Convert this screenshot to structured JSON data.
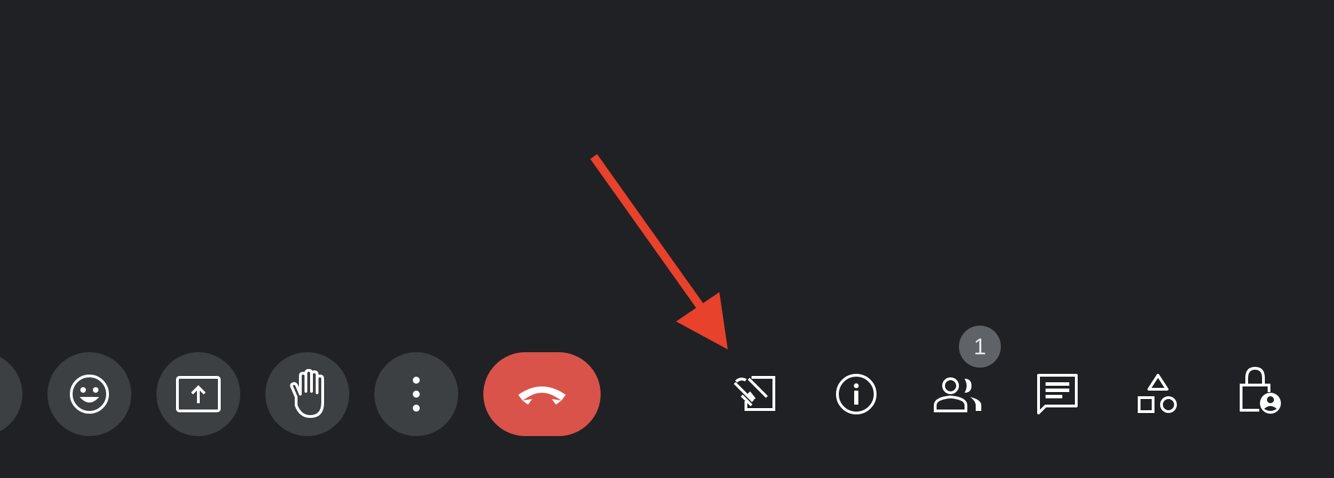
{
  "toolbar": {
    "left_buttons": [
      {
        "name": "partial-button",
        "icon": "partial-icon"
      },
      {
        "name": "emoji-button",
        "icon": "smiley-icon"
      },
      {
        "name": "present-button",
        "icon": "present-screen-icon"
      },
      {
        "name": "raise-hand-button",
        "icon": "hand-icon"
      },
      {
        "name": "more-options-button",
        "icon": "more-vert-icon"
      }
    ],
    "end_call": {
      "icon": "phone-hangup-icon",
      "color": "#d9534a"
    },
    "right_icons": [
      {
        "name": "host-controls-button",
        "icon": "edit-off-icon"
      },
      {
        "name": "meeting-details-button",
        "icon": "info-icon"
      },
      {
        "name": "people-button",
        "icon": "people-icon"
      },
      {
        "name": "chat-button",
        "icon": "chat-icon"
      },
      {
        "name": "activities-button",
        "icon": "shapes-icon"
      },
      {
        "name": "host-safety-button",
        "icon": "lock-person-icon"
      }
    ],
    "people_count": "1"
  },
  "colors": {
    "background": "#202124",
    "button_bg": "#3c4043",
    "badge_bg": "#5f6368",
    "annotation_arrow": "#e8412c"
  }
}
